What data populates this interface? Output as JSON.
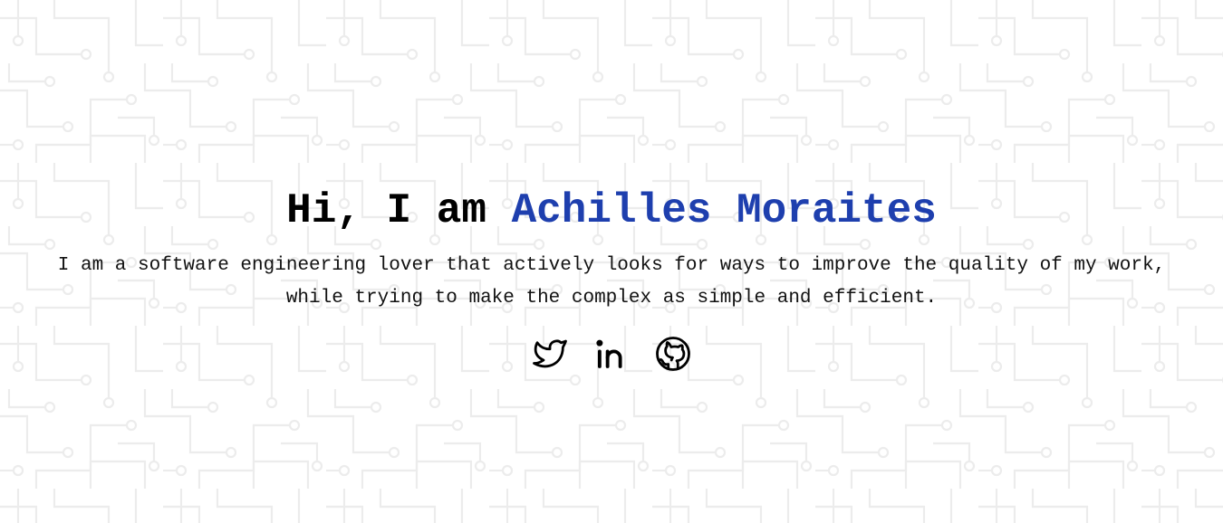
{
  "hero": {
    "greeting": "Hi, I am ",
    "name": "Achilles Moraites",
    "tagline": "I am a software engineering lover that actively looks for ways to improve the quality of my work, while trying to make the complex as simple and efficient."
  },
  "socials": [
    {
      "icon": "twitter-icon",
      "label": "Twitter"
    },
    {
      "icon": "linkedin-icon",
      "label": "LinkedIn"
    },
    {
      "icon": "github-icon",
      "label": "GitHub"
    }
  ],
  "colors": {
    "accent": "#1e3fae",
    "text": "#000000",
    "background": "#ffffff",
    "pattern": "#ececec"
  }
}
